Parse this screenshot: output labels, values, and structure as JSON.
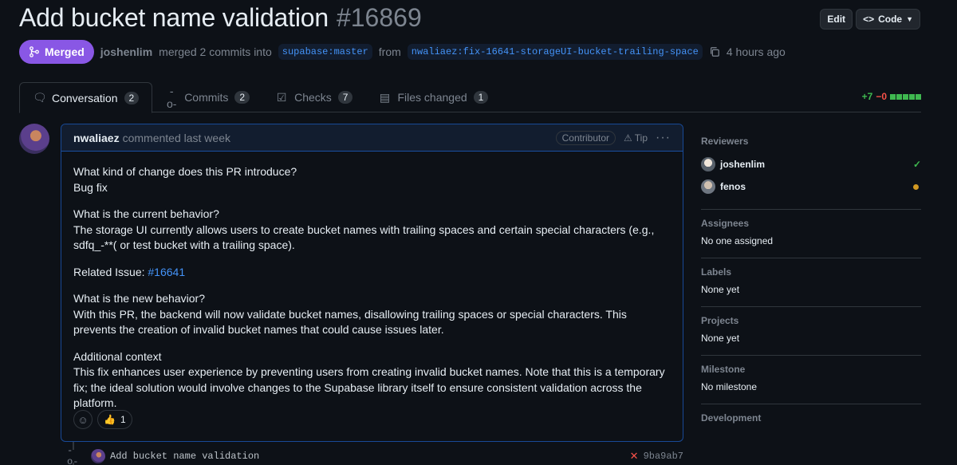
{
  "pr": {
    "title": "Add bucket name validation",
    "number": "#16869",
    "state": "Merged",
    "merged_by": "joshenlim",
    "merge_text": "merged 2 commits into",
    "base_branch": "supabase:master",
    "from_text": "from",
    "head_branch": "nwaliaez:fix-16641-storageUI-bucket-trailing-space",
    "time": "4 hours ago"
  },
  "actions": {
    "edit": "Edit",
    "code": "Code"
  },
  "tabs": [
    {
      "label": "Conversation",
      "count": "2",
      "icon": "comment-icon"
    },
    {
      "label": "Commits",
      "count": "2",
      "icon": "commit-icon"
    },
    {
      "label": "Checks",
      "count": "7",
      "icon": "checklist-icon"
    },
    {
      "label": "Files changed",
      "count": "1",
      "icon": "file-diff-icon"
    }
  ],
  "diffstat": {
    "additions": "+7",
    "deletions": "−0"
  },
  "comment": {
    "author": "nwaliaez",
    "action": "commented last week",
    "badge": "Contributor",
    "tip": "Tip",
    "q1": "What kind of change does this PR introduce?",
    "a1": "Bug fix",
    "q2": "What is the current behavior?",
    "a2": "The storage UI currently allows users to create bucket names with trailing spaces and certain special characters (e.g., sdfq_-**( or test bucket with a trailing space).",
    "related_label": "Related Issue:",
    "related_link": "#16641",
    "q3": "What is the new behavior?",
    "a3": "With this PR, the backend will now validate bucket names, disallowing trailing spaces or special characters. This prevents the creation of invalid bucket names that could cause issues later.",
    "q4": "Additional context",
    "a4": "This fix enhances user experience by preventing users from creating invalid bucket names. Note that this is a temporary fix; the ideal solution would involve changes to the Supabase library itself to ensure consistent validation across the platform.",
    "reaction_emoji": "👍",
    "reaction_count": "1"
  },
  "commit": {
    "message": "Add bucket name validation",
    "sha": "9ba9ab7"
  },
  "sidebar": {
    "reviewers_title": "Reviewers",
    "reviewers": [
      {
        "name": "joshenlim",
        "status": "approved"
      },
      {
        "name": "fenos",
        "status": "pending"
      }
    ],
    "assignees_title": "Assignees",
    "assignees_value": "No one assigned",
    "labels_title": "Labels",
    "labels_value": "None yet",
    "projects_title": "Projects",
    "projects_value": "None yet",
    "milestone_title": "Milestone",
    "milestone_value": "No milestone",
    "development_title": "Development"
  },
  "colors": {
    "merged": "#8957e5",
    "link": "#4493f8",
    "success": "#3fb950",
    "danger": "#f85149",
    "pending": "#d29922"
  }
}
